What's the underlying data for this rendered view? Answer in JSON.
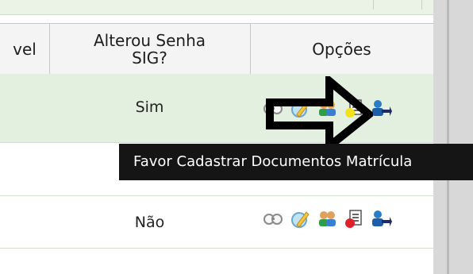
{
  "table": {
    "headers": {
      "col1": "vel",
      "col2_line1": "Alterou Senha",
      "col2_line2": "SIG?",
      "col3": "Opções"
    },
    "rows": [
      {
        "alterou": "Sim",
        "highlighted": true
      },
      {
        "alterou": "",
        "highlighted": false
      },
      {
        "alterou": "Não",
        "highlighted": false
      }
    ]
  },
  "tooltip": {
    "text": "Favor Cadastrar Documentos Matrícula"
  },
  "icons": [
    "view-icon",
    "edit-pencil-icon",
    "users-icon",
    "document-status-icon",
    "transfer-user-icon"
  ],
  "colors": {
    "row_highlight": "#e3efdf",
    "tooltip_bg": "#151515",
    "status_yellow": "#f3e21a",
    "status_red": "#e0202a"
  }
}
